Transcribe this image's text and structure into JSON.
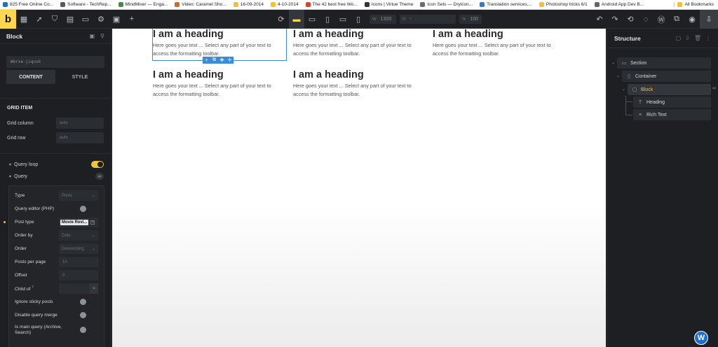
{
  "bookmarks": [
    {
      "label": "825 Free Online Co...",
      "color": "#1d73b8"
    },
    {
      "label": "Software - TechRep...",
      "color": "#5a5a5a"
    },
    {
      "label": "MindMixer — Enga...",
      "color": "#3c8f45"
    },
    {
      "label": "Video: Caramel Sho...",
      "color": "#e0651b"
    },
    {
      "label": "16-09-2014",
      "color": "#f2c12e"
    },
    {
      "label": "4-10-2014",
      "color": "#f2c12e"
    },
    {
      "label": "The 42 best free Wo...",
      "color": "#d9442f"
    },
    {
      "label": "Icons | Virtue Theme",
      "color": "#333333"
    },
    {
      "label": "Icon Sets — Drylcon...",
      "color": "#6d6d6d"
    },
    {
      "label": "Translation services,...",
      "color": "#3a78c2"
    },
    {
      "label": "Photoshop tricks  6/1",
      "color": "#f2c12e"
    },
    {
      "label": "Android App Dev B...",
      "color": "#666666"
    }
  ],
  "bookmarks_all": "All Bookmarks",
  "toolbar": {
    "logo": "b",
    "width_label": "W",
    "width_value": "1320",
    "height_label": "H",
    "height_value": "-",
    "zoom_label": "%",
    "zoom_value": "100"
  },
  "left_panel": {
    "title": "Block",
    "css_id": "#brxe-jiqusk",
    "tabs": [
      "CONTENT",
      "STYLE"
    ],
    "grid_item_title": "GRID ITEM",
    "grid_column_label": "Grid column",
    "grid_column_placeholder": "auto",
    "grid_row_label": "Grid row",
    "grid_row_placeholder": "auto",
    "query_loop_label": "Query loop",
    "query_label": "Query",
    "query_icon": "∞"
  },
  "query": {
    "type_label": "Type",
    "type_value": "Posts",
    "editor_label": "Query editor (PHP)",
    "post_type_label": "Post type",
    "post_type_value": "Movie Revi...",
    "order_by_label": "Order by",
    "order_by_value": "Date",
    "order_label": "Order",
    "order_value": "Descending",
    "posts_per_page_label": "Posts per page",
    "posts_per_page_value": "10",
    "offset_label": "Offset",
    "offset_value": "0",
    "child_of_label": "Child of",
    "ignore_sticky_label": "Ignore sticky posts",
    "disable_merge_label": "Disable query merge",
    "is_main_label_1": "Is main query (Archive,",
    "is_main_label_2": "Search)"
  },
  "canvas": {
    "cells": [
      {
        "heading": "I am a heading",
        "text": "Here goes your text ... Select any part of your text to access the formatting toolbar."
      },
      {
        "heading": "I am a heading",
        "text": "Here goes your text ... Select any part of your text to access the formatting toolbar."
      },
      {
        "heading": "I am a heading",
        "text": "Here goes your text ... Select any part of your text to access the formatting toolbar."
      },
      {
        "heading": "I am a heading",
        "text": "Here goes your text ... Select any part of your text to access the formatting toolbar."
      },
      {
        "heading": "I am a heading",
        "text": "Here goes your text ... Select any part of your text to access the formatting toolbar."
      }
    ]
  },
  "structure": {
    "title": "Structure",
    "nodes": [
      "Section",
      "Container",
      "Block",
      "Heading",
      "Rich Text"
    ]
  },
  "colors": {
    "accent": "#ffd64f",
    "selection": "#3b8bd6",
    "panel_bg": "#1d1f22"
  }
}
